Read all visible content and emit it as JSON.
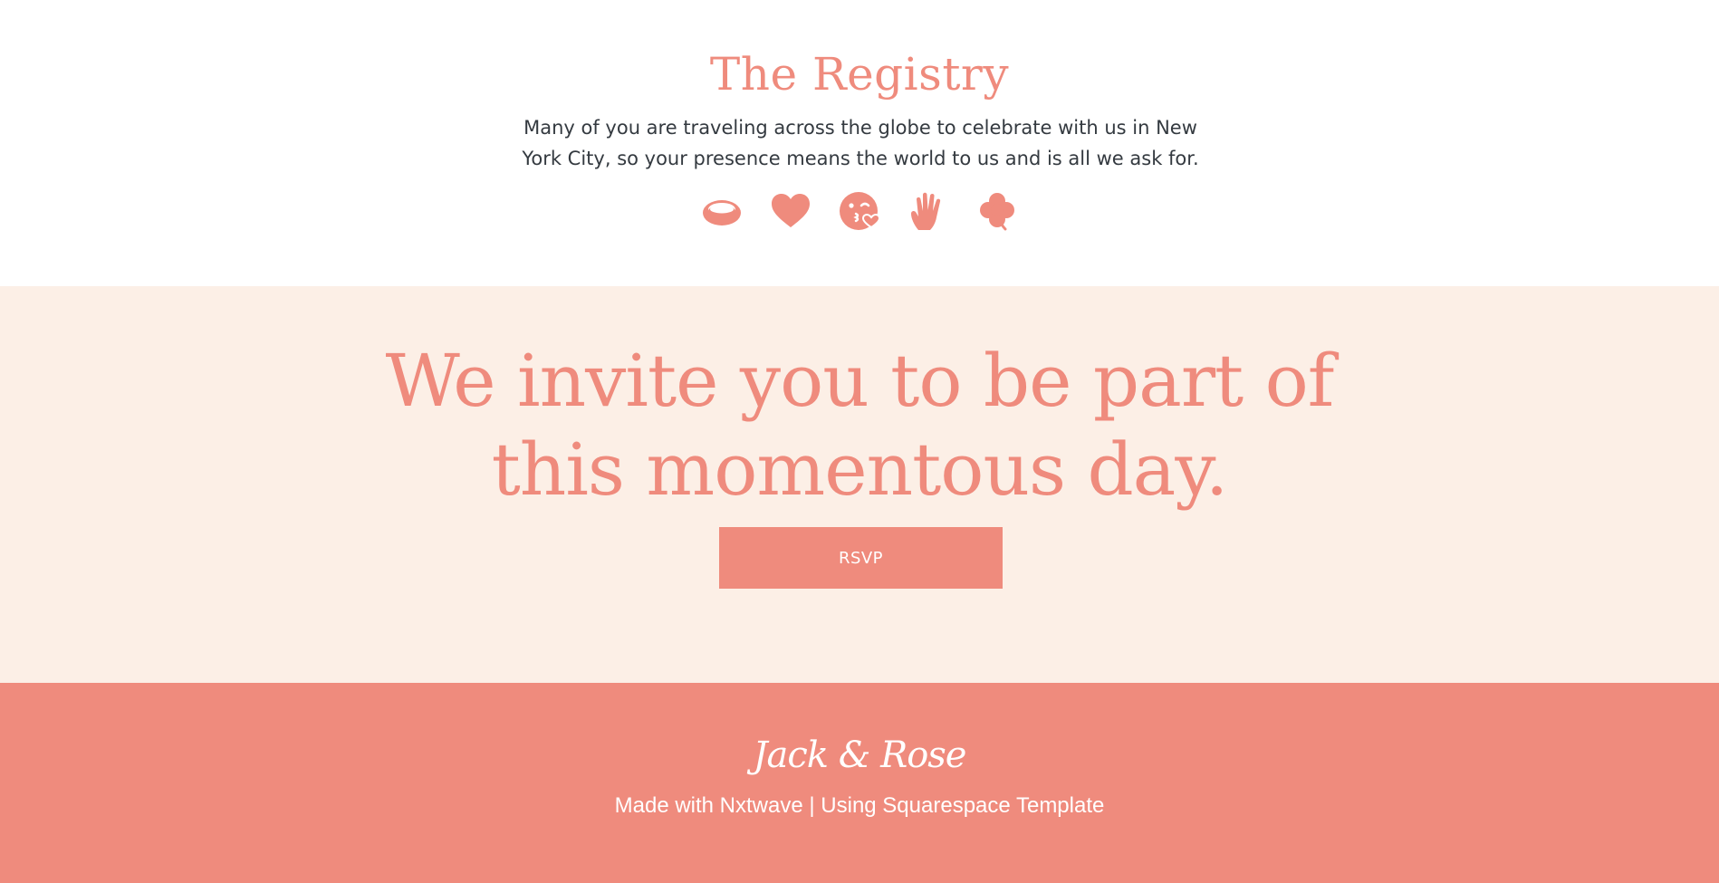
{
  "registry": {
    "title": "The Registry",
    "description": "Many of you are traveling across the globe to celebrate with us in New York City, so your presence means the world to us and is all we ask for.",
    "icons": [
      "ring-icon",
      "heart-icon",
      "kissing-face-icon",
      "raised-hand-icon",
      "clover-icon"
    ],
    "icon_color": "#ef8b7d"
  },
  "invite": {
    "heading": "We invite you to be part of this momentous day.",
    "rsvp_label": "RSVP",
    "background_color": "#fcefe6"
  },
  "footer": {
    "logo": "Jack & Rose",
    "credit": "Made with Nxtwave | Using Squarespace Template",
    "background_color": "#ef8b7d"
  }
}
